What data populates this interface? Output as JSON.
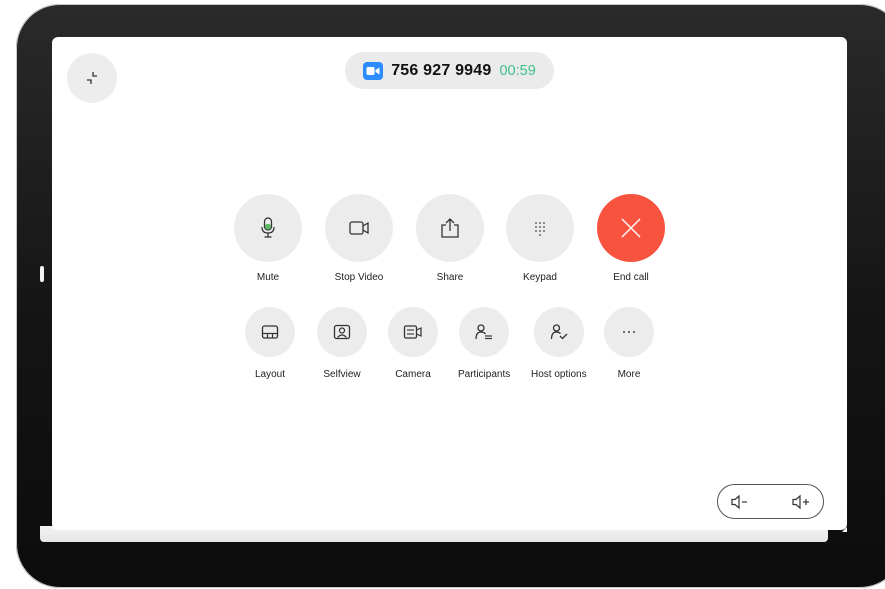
{
  "call": {
    "number": "756 927 9949",
    "timer": "00:59"
  },
  "controls_primary": [
    {
      "label": "Mute",
      "icon": "microphone-icon"
    },
    {
      "label": "Stop Video",
      "icon": "video-camera-icon"
    },
    {
      "label": "Share",
      "icon": "share-icon"
    },
    {
      "label": "Keypad",
      "icon": "keypad-icon"
    },
    {
      "label": "End call",
      "icon": "close-icon"
    }
  ],
  "controls_secondary": [
    {
      "label": "Layout",
      "icon": "layout-icon"
    },
    {
      "label": "Selfview",
      "icon": "selfview-icon"
    },
    {
      "label": "Camera",
      "icon": "camera-control-icon"
    },
    {
      "label": "Participants",
      "icon": "participants-icon"
    },
    {
      "label": "Host options",
      "icon": "host-options-icon"
    },
    {
      "label": "More",
      "icon": "more-icon"
    }
  ],
  "colors": {
    "end_call": "#f7533f",
    "timer": "#3fbf8c",
    "video_badge": "#2d8cff",
    "button_bg": "#ececec"
  }
}
